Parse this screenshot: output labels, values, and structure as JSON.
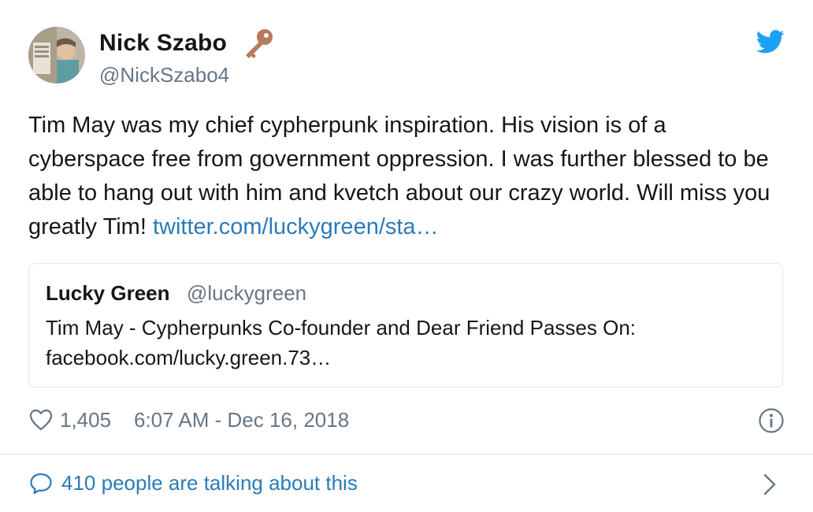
{
  "author": {
    "name": "Nick Szabo",
    "handle": "@NickSzabo4",
    "badge_icon": "key-icon",
    "avatar_icon": "avatar-photo"
  },
  "brand": {
    "icon": "twitter-bird-icon",
    "color": "#1da1f2"
  },
  "tweet": {
    "text": "Tim May was my chief cypherpunk inspiration. His vision is of a cyberspace free from government oppression. I was further blessed to be able to hang out with him and kvetch about our crazy world. Will miss you greatly Tim!",
    "link_text": "twitter.com/luckygreen/sta…",
    "link_color": "#2b7bb9"
  },
  "quoted_tweet": {
    "name": "Lucky Green",
    "handle": "@luckygreen",
    "text_line1": "Tim May - Cypherpunks Co-founder and Dear Friend Passes On:",
    "text_line2": "facebook.com/lucky.green.73…"
  },
  "footer": {
    "like_icon": "heart-icon",
    "like_count": "1,405",
    "timestamp": "6:07 AM - Dec 16, 2018",
    "info_icon": "info-icon"
  },
  "conversation": {
    "icon": "chat-bubble-icon",
    "text": "410 people are talking about this",
    "chevron_icon": "chevron-right-icon"
  }
}
